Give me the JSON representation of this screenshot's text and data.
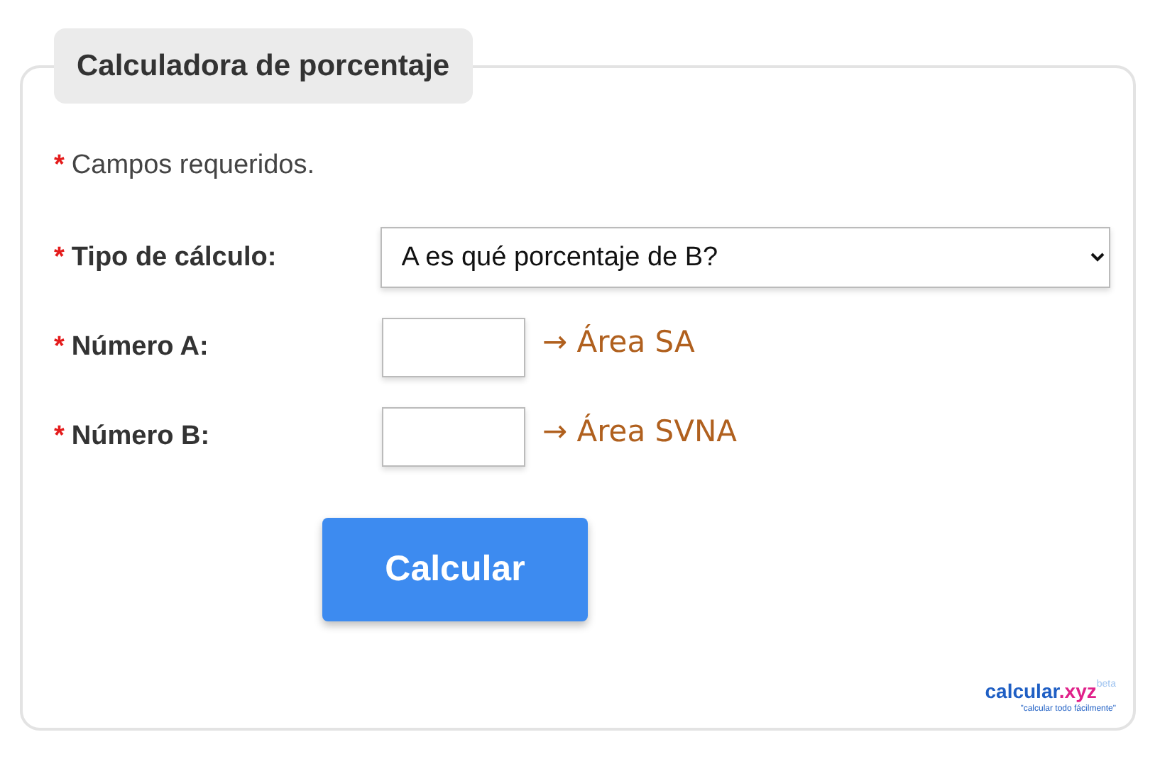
{
  "form": {
    "title": "Calculadora de porcentaje",
    "note": {
      "mark": "*",
      "text": "Campos requeridos."
    },
    "fields": [
      {
        "kind": "select",
        "mark": "*",
        "label": "Tipo de cálculo:",
        "value": "A es qué porcentaje de B?"
      },
      {
        "kind": "input",
        "mark": "*",
        "label": "Número A:",
        "hint": "→ Área SA"
      },
      {
        "kind": "input",
        "mark": "*",
        "label": "Número B:",
        "hint": "→ Área SVNA"
      }
    ],
    "button": "Calcular",
    "logo": {
      "name": "calcular",
      "tld": ".xyz",
      "badge": "beta",
      "tagline": "\"calcular todo fácilmente\""
    }
  }
}
